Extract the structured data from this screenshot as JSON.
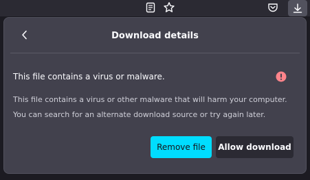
{
  "toolbar": {
    "icons": [
      "reader-view-icon",
      "bookmark-star-icon",
      "pocket-icon",
      "downloads-icon"
    ]
  },
  "panel": {
    "title": "Download details",
    "back_icon": "chevron-left-icon",
    "warning_icon": "exclamation-circle-icon",
    "heading": "This file contains a virus or malware.",
    "description_line1": "This file contains a virus or other malware that will harm your computer.",
    "description_line2": "You can search for an alternate download source or try again later.",
    "remove_label": "Remove file",
    "allow_label": "Allow download"
  },
  "colors": {
    "accent": "#00ddff",
    "warning": "#ff848b",
    "panel_bg": "#42414d",
    "toolbar_bg": "#2b2a33"
  }
}
